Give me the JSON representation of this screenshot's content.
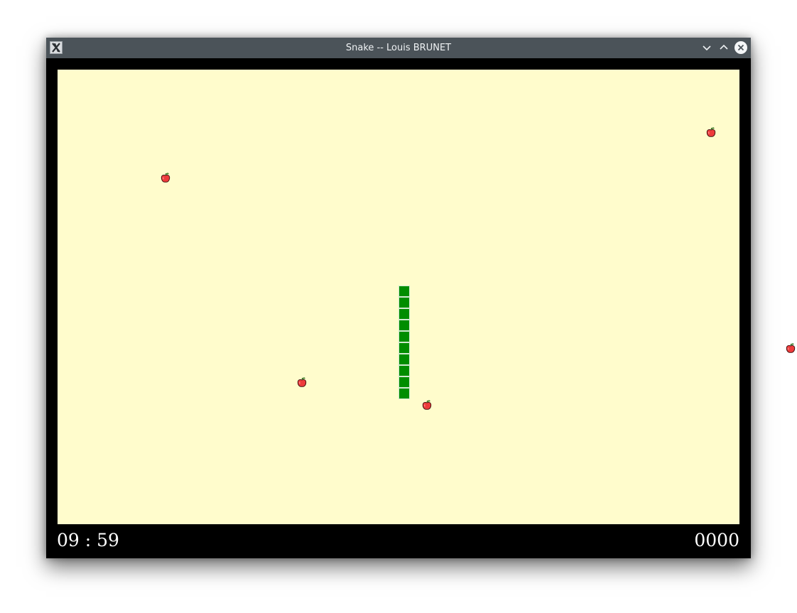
{
  "window": {
    "title": "Snake -- Louis BRUNET",
    "icons": {
      "app": "x-app-icon",
      "minimize": "chevron-down-icon",
      "maximize": "chevron-up-icon",
      "close": "close-circle-icon"
    }
  },
  "game": {
    "board_color": "#fffccc",
    "snake_color": "#008d00",
    "apple_color": "#ee3b3b",
    "grid_cell": "16 px",
    "snake_cells": [
      [
        30,
        19
      ],
      [
        30,
        20
      ],
      [
        30,
        21
      ],
      [
        30,
        22
      ],
      [
        30,
        23
      ],
      [
        30,
        24
      ],
      [
        30,
        25
      ],
      [
        30,
        26
      ],
      [
        30,
        27
      ],
      [
        30,
        28
      ]
    ],
    "apple_cells": [
      [
        9,
        9
      ],
      [
        57,
        5
      ],
      [
        64,
        24
      ],
      [
        21,
        27
      ],
      [
        32,
        29
      ]
    ]
  },
  "status": {
    "timer": "09 : 59",
    "score": "0000"
  }
}
